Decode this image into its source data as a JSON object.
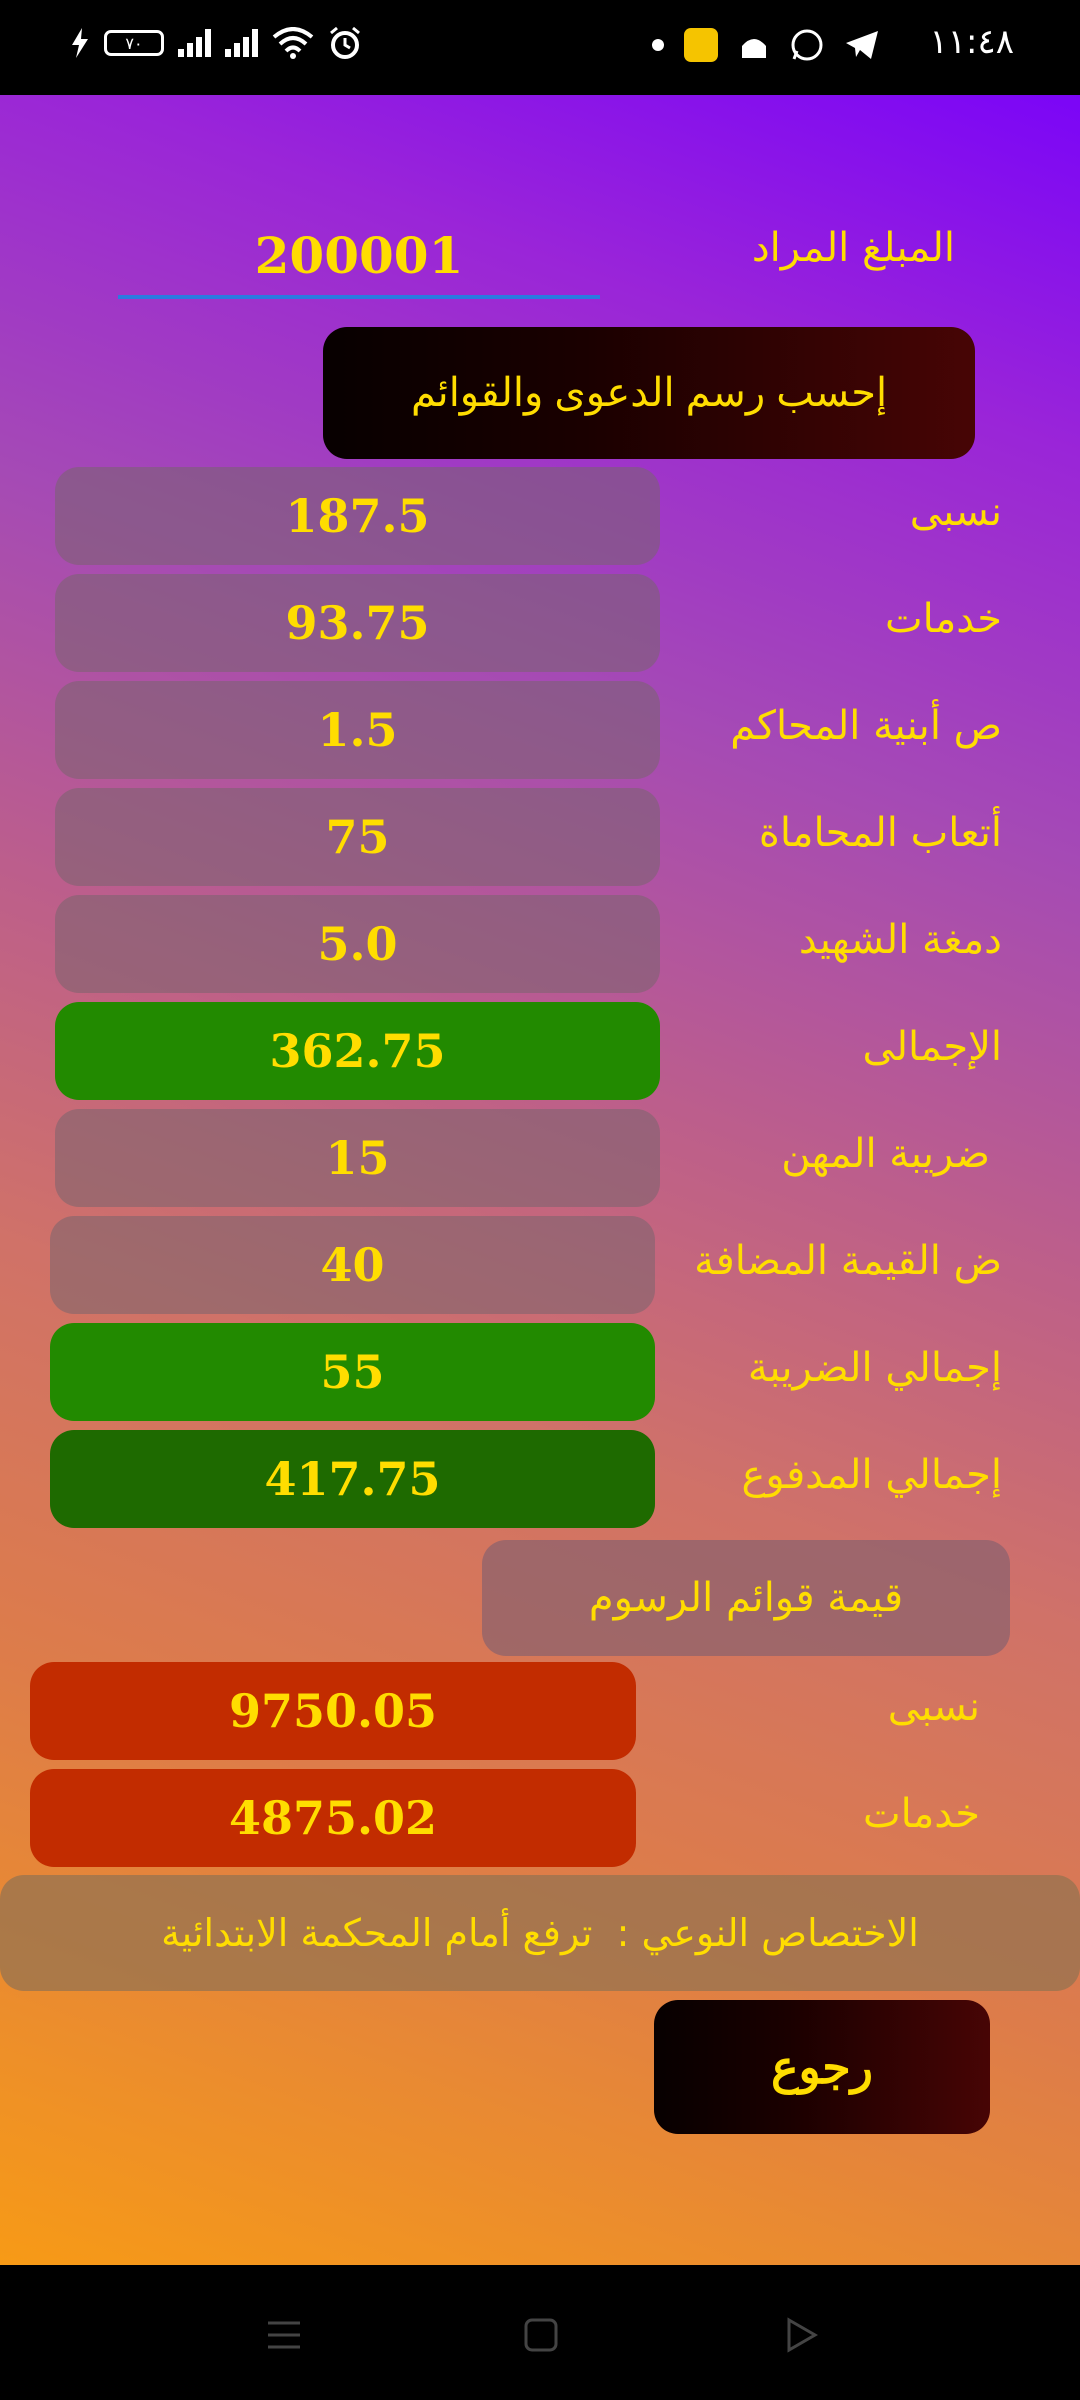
{
  "status_bar": {
    "time": "١١:٤٨",
    "battery_level": "٧٠"
  },
  "form": {
    "amount_label": "المبلغ المراد",
    "amount_value": "200001",
    "calculate_button": "إحسب رسم الدعوى والقوائم"
  },
  "results": [
    {
      "label": "نسبى",
      "value": "187.5"
    },
    {
      "label": "خدمات",
      "value": "93.75"
    },
    {
      "label": "ص أبنية المحاكم",
      "value": "1.5"
    },
    {
      "label": "أتعاب المحاماة",
      "value": "75"
    },
    {
      "label": "دمغة الشهيد",
      "value": "5.0"
    },
    {
      "label": "الإجمالى",
      "value": "362.75"
    },
    {
      "label": "ضريبة المهن",
      "value": "15"
    },
    {
      "label": "ض القيمة المضافة",
      "value": "40"
    },
    {
      "label": "إجمالي الضريبة",
      "value": "55"
    },
    {
      "label": "إجمالي المدفوع",
      "value": "417.75"
    }
  ],
  "lists": {
    "title": "قيمة قوائم الرسوم",
    "items": [
      {
        "label": "نسبى",
        "value": "9750.05"
      },
      {
        "label": "خدمات",
        "value": "4875.02"
      }
    ]
  },
  "info": {
    "jurisdiction": "الاختصاص النوعي :  ترفع أمام المحكمة الابتدائية"
  },
  "back_button": "رجوع",
  "colors": {
    "accent_text": "#ffdd00",
    "total_green": "#228a00",
    "paid_green": "#1e6a00",
    "lists_red": "#c22c00"
  }
}
